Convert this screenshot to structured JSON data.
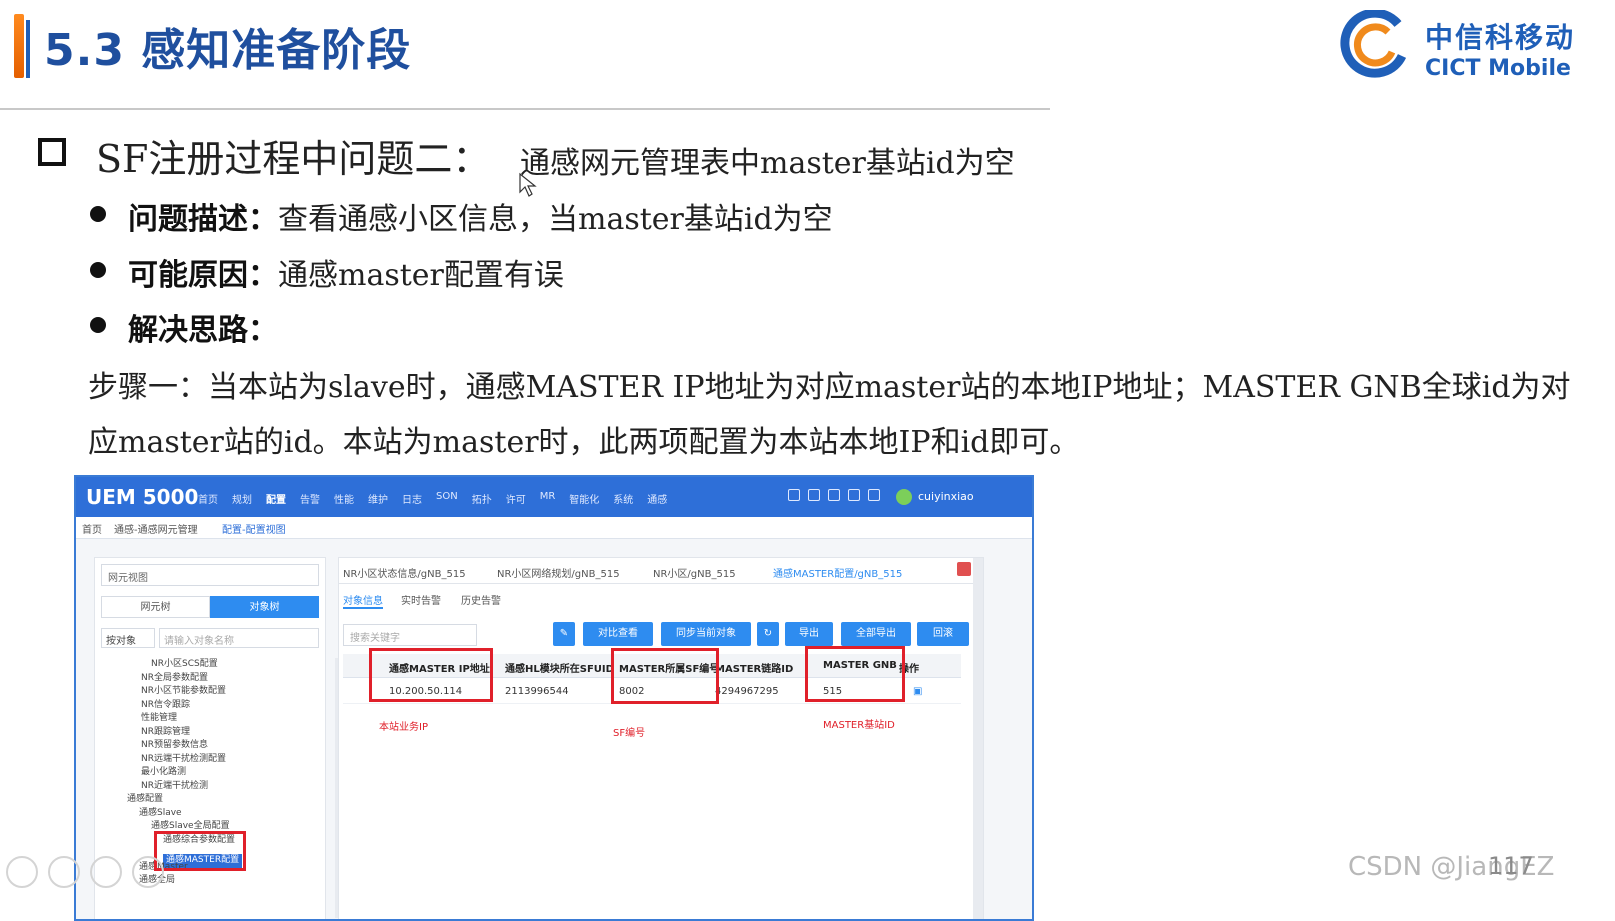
{
  "slide": {
    "title": "5.3 感知准备阶段",
    "logo_cn": "中信科移动",
    "logo_en": "CICT Mobile",
    "heading_main": "SF注册过程中问题二：",
    "heading_sub": "通感网元管理表中master基站id为空",
    "bullets": [
      {
        "label": "问题描述：",
        "text": "查看通感小区信息，当master基站id为空"
      },
      {
        "label": "可能原因：",
        "text": "通感master配置有误"
      },
      {
        "label": "解决思路：",
        "text": ""
      }
    ],
    "step_line1": "步骤一：当本站为slave时，通感MASTER IP地址为对应master站的本地IP地址；MASTER GNB全球id为对",
    "step_line2": "应master站的id。本站为master时，此两项配置为本站本地IP和id即可。",
    "watermark": "CSDN @JiangEZ",
    "page_number": "117"
  },
  "app": {
    "brand": "UEM 5000",
    "nav": [
      "首页",
      "规划",
      "配置",
      "告警",
      "性能",
      "维护",
      "日志",
      "SON",
      "拓扑",
      "许可",
      "MR",
      "智能化",
      "系统",
      "通感"
    ],
    "user": "cuiyinxiao",
    "breadcrumbs": [
      "首页",
      "通感-通感网元管理",
      "配置-配置视图"
    ],
    "left": {
      "view_select": "网元视图",
      "tabs": [
        "网元树",
        "对象树"
      ],
      "filter": "按对象",
      "search_placeholder": "请输入对象名称",
      "tree": [
        "NR小区SCS配置",
        "NR全局参数配置",
        "NR小区节能参数配置",
        "NR信令跟踪",
        "性能管理",
        "NR跟踪管理",
        "NR预留参数信息",
        "NR远端干扰检测配置",
        "最小化路测",
        "NR近端干扰检测",
        "通感配置",
        "通感Slave",
        "通感Slave全局配置",
        "通感综合参数配置",
        "通感MASTER配置",
        "通感Master",
        "通感全局"
      ]
    },
    "main": {
      "tabs": [
        "NR小区状态信息/gNB_515",
        "NR小区网络规划/gNB_515",
        "NR小区/gNB_515",
        "通感MASTER配置/gNB_515"
      ],
      "subtabs": [
        "对象信息",
        "实时告警",
        "历史告警"
      ],
      "keyword_placeholder": "搜索关键字",
      "buttons": [
        "对比查看",
        "同步当前对象",
        "导出",
        "全部导出",
        "回滚"
      ],
      "columns": [
        "通感MASTER IP地址",
        "通感HL模块所在SFUID",
        "MASTER所属SF编号",
        "MASTER链路ID",
        "MASTER GNB",
        "操作"
      ],
      "row": [
        "10.200.50.114",
        "2113996544",
        "8002",
        "4294967295",
        "515"
      ],
      "annotations": [
        "本站业务IP",
        "SF编号",
        "MASTER基站ID"
      ]
    }
  },
  "colors": {
    "accent": "#1f4f9e",
    "orange": "#e45f00",
    "nav": "#2e6fd8",
    "highlight": "#e0202a"
  }
}
